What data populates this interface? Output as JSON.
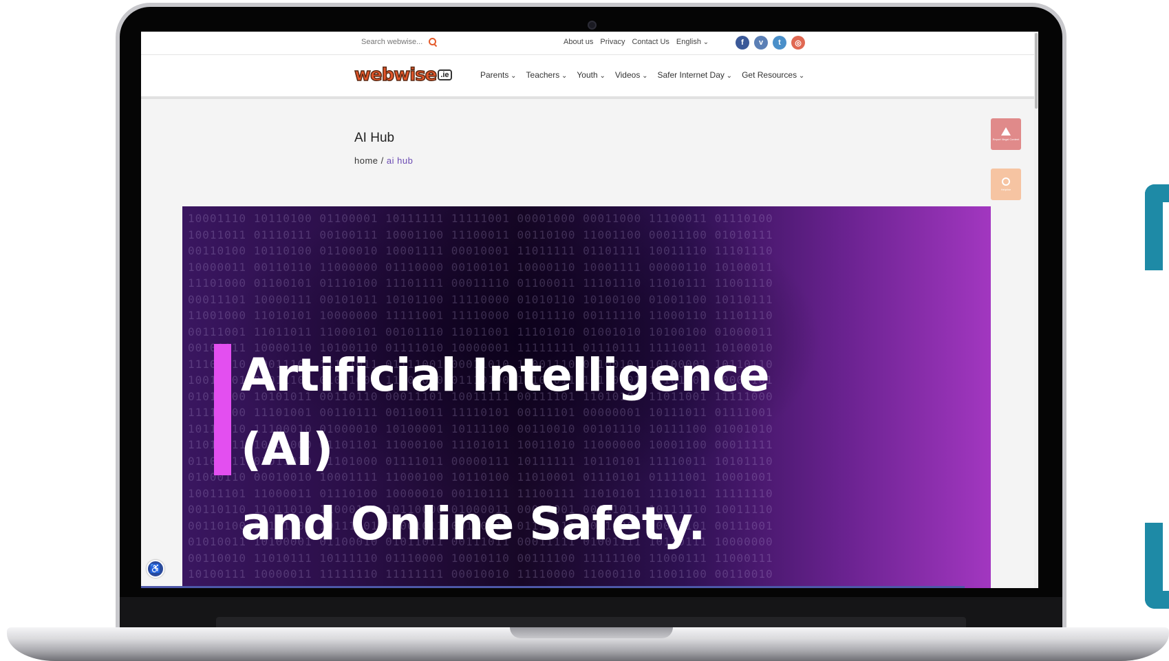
{
  "topbar": {
    "search_placeholder": "Search webwise...",
    "links": [
      "About us",
      "Privacy",
      "Contact Us",
      "English"
    ],
    "social": [
      {
        "icon": "facebook-icon",
        "glyph": "f"
      },
      {
        "icon": "vimeo-icon",
        "glyph": "v"
      },
      {
        "icon": "twitter-icon",
        "glyph": "t"
      },
      {
        "icon": "instagram-icon",
        "glyph": "◎"
      }
    ]
  },
  "logo": {
    "text": "webwise",
    "badge": ".ie"
  },
  "nav": {
    "items": [
      "Parents",
      "Teachers",
      "Youth",
      "Videos",
      "Safer Internet Day",
      "Get Resources"
    ]
  },
  "page": {
    "title": "AI Hub",
    "breadcrumb_home": "home",
    "breadcrumb_sep": " / ",
    "breadcrumb_current": "ai hub"
  },
  "side_buttons": {
    "report_label": "Report Illegal Content",
    "helpline_label": "Helpline"
  },
  "hero": {
    "line1": "Artificial Intelligence (AI)",
    "line2": "and Online Safety."
  },
  "colors": {
    "accent": "#e34ff0",
    "brand": "#e2552a",
    "teal": "#1e8aa6",
    "link": "#6b4bb3"
  }
}
